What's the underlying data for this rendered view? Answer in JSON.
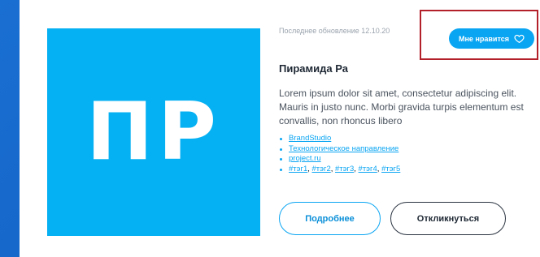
{
  "colors": {
    "accent": "#0aa5f2",
    "tile": "#06b1f3",
    "highlight_frame": "#b3202a",
    "background": "#1566c8"
  },
  "card": {
    "logo_text": "ПР",
    "updated_label": "Последнее обновление 12.10.20",
    "like_label": "Мне нравится",
    "like_icon": "heart-icon",
    "title": "Пирамида Ра",
    "description": "Lorem ipsum dolor sit amet, consectetur adipiscing elit. Mauris in justo nunc. Morbi gravida turpis elementum est convallis, non rhoncus libero",
    "links": [
      "BrandStudio",
      "Технологическое направление",
      "project.ru"
    ],
    "hashtags": [
      "#тэг1",
      "#тэг2",
      "#тэг3",
      "#тэг4",
      "#тэг5"
    ],
    "more_button": "Подробнее",
    "respond_button": "Откликнуться"
  }
}
